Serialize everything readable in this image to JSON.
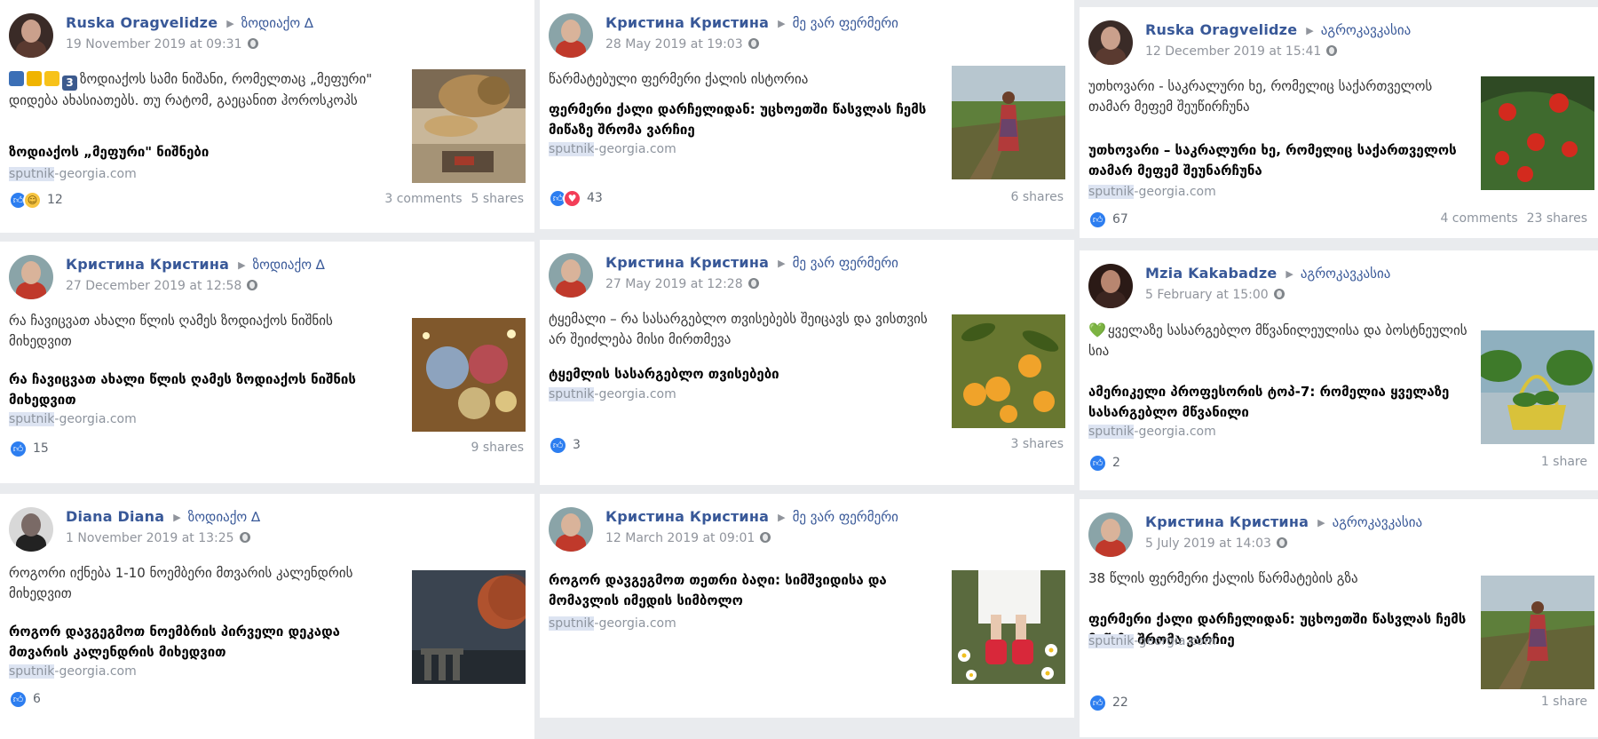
{
  "posts": [
    {
      "author": "Ruska Oragvelidze",
      "group": "ზოდიაქო ∆",
      "timestamp": "19 November 2019 at 09:31",
      "prefix_emoji": [
        "calendar-icon",
        "crown-icon",
        "star-icon"
      ],
      "prefix_badge": "3",
      "text": "ზოდიაქოს სამი ნიშანი, რომელთაც „მეფური\" დიდება ახასიათებს. თუ რატომ, გაეცანით ჰოროსკოპს",
      "headline": "ზოდიაქოს „მეფური\" ნიშნები",
      "domain_hl": "sputnik",
      "domain_rest": "-georgia.com",
      "reactions": [
        "like",
        "haha"
      ],
      "reaction_count": "12",
      "comments": "3 comments",
      "shares": "5 shares",
      "thumb": "lion-on-sofa",
      "avatar_colors": [
        "#3a2b27",
        "#caa08c",
        "#5a3a30"
      ]
    },
    {
      "author": "Кристина Кристина",
      "group": "მე ვარ ფერმერი",
      "timestamp": "28 May 2019 at 19:03",
      "text": "წარმატებული ფერმერი ქალის ისტორია",
      "headline": "ფერმერი ქალი დარჩელიდან: უცხოეთში წასვლას ჩემს მიწაზე შრომა ვარჩიე",
      "domain_hl": "sputnik",
      "domain_rest": "-georgia.com",
      "reactions": [
        "like",
        "love"
      ],
      "reaction_count": "43",
      "comments": "",
      "shares": "6 shares",
      "thumb": "woman-in-field",
      "avatar_colors": [
        "#8aa4a8",
        "#d9b39a",
        "#c0392b"
      ]
    },
    {
      "author": "Ruska Oragvelidze",
      "group": "აგროკავკასია",
      "timestamp": "12 December 2019 at 15:41",
      "text": "უთხოვარი - საკრალური ხე, რომელიც საქართველოს თამარ მეფემ შეუწირჩუნა",
      "headline": "უთხოვარი – საკრალური ხე, რომელიც საქართველოს თამარ მეფემ შეუნარჩუნა",
      "domain_hl": "sputnik",
      "domain_rest": "-georgia.com",
      "reactions": [
        "like"
      ],
      "reaction_count": "67",
      "comments": "4 comments",
      "shares": "23 shares",
      "thumb": "yew-berries",
      "avatar_colors": [
        "#3a2b27",
        "#caa08c",
        "#5a3a30"
      ]
    },
    {
      "author": "Кристина Кристина",
      "group": "ზოდიაქო ∆",
      "timestamp": "27 December 2019 at 12:58",
      "text": "რა ჩავიცვათ ახალი წლის ღამეს ზოდიაქოს ნიშნის მიხედვით",
      "headline": "რა ჩავიცვათ ახალი წლის ღამეს ზოდიაქოს ნიშნის მიხედვით",
      "domain_hl": "sputnik",
      "domain_rest": "-georgia.com",
      "reactions": [
        "like"
      ],
      "reaction_count": "15",
      "comments": "",
      "shares": "9 shares",
      "thumb": "christmas-baubles",
      "avatar_colors": [
        "#8aa4a8",
        "#d9b39a",
        "#c0392b"
      ]
    },
    {
      "author": "Кристина Кристина",
      "group": "მე ვარ ფერმერი",
      "timestamp": "27 May 2019 at 12:28",
      "text": "ტყემალი – რა სასარგებლო თვისებებს შეიცავს და ვისთვის არ შეიძლება მისი მირთმევა",
      "headline": "ტყემლის სასარგებლო თვისებები",
      "domain_hl": "sputnik",
      "domain_rest": "-georgia.com",
      "reactions": [
        "like"
      ],
      "reaction_count": "3",
      "comments": "",
      "shares": "3 shares",
      "thumb": "yellow-plums",
      "avatar_colors": [
        "#8aa4a8",
        "#d9b39a",
        "#c0392b"
      ]
    },
    {
      "author": "Mzia Kakabadze",
      "group": "აგროკავკასია",
      "timestamp": "5 February at 15:00",
      "prefix_heart": "💚",
      "text": "ყველაზე სასარგებლო მწვანილეულისა და ბოსტნეულის სია",
      "headline": "ამერიკელი პროფესორის ტოპ-7: რომელია ყველაზე სასარგებლო მწვანილი",
      "domain_hl": "sputnik",
      "domain_rest": "-georgia.com",
      "reactions": [
        "like"
      ],
      "reaction_count": "2",
      "comments": "",
      "shares": "1 share",
      "thumb": "greens-basket",
      "avatar_colors": [
        "#2b1a16",
        "#b88670",
        "#3b2520"
      ]
    },
    {
      "author": "Diana Diana",
      "group": "ზოდიაქო ∆",
      "timestamp": "1 November 2019 at 13:25",
      "text": "როგორი იქნება 1-10 ნოემბერი მთვარის კალენდრის მიხედვით",
      "headline": "როგორ დავგეგმოთ ნოემბრის პირველი დეკადა მთვარის კალენდრის მიხედვით",
      "domain_hl": "sputnik",
      "domain_rest": "-georgia.com",
      "reactions": [
        "like"
      ],
      "reaction_count": "6",
      "comments": "",
      "shares": "",
      "thumb": "red-moon",
      "avatar_colors": [
        "#d8d8d8",
        "#7a6a66",
        "#222222"
      ]
    },
    {
      "author": "Кристина Кристина",
      "group": "მე ვარ ფერმერი",
      "timestamp": "12 March 2019 at 09:01",
      "text": "",
      "headline": "როგორ დავგეგმოთ თეთრი ბაღი: სიმშვიდისა და მომავლის იმედის სიმბოლო",
      "domain_hl": "sputnik",
      "domain_rest": "-georgia.com",
      "reactions": [],
      "reaction_count": "",
      "comments": "",
      "shares": "",
      "thumb": "red-sneakers-daisies",
      "avatar_colors": [
        "#8aa4a8",
        "#d9b39a",
        "#c0392b"
      ]
    },
    {
      "author": "Кристина Кристина",
      "group": "აგროკავკასია",
      "timestamp": "5 July 2019 at 14:03",
      "text": "38 წლის ფერმერი ქალის წარმატების გზა",
      "headline": "ფერმერი ქალი დარჩელიდან: უცხოეთში წასვლას ჩემს მიწაზე შრომა ვარჩიე",
      "domain_hl": "sputnik",
      "domain_rest": "-georgia.com",
      "reactions": [
        "like"
      ],
      "reaction_count": "22",
      "comments": "",
      "shares": "1 share",
      "thumb": "woman-in-field",
      "avatar_colors": [
        "#8aa4a8",
        "#d9b39a",
        "#c0392b"
      ]
    }
  ]
}
